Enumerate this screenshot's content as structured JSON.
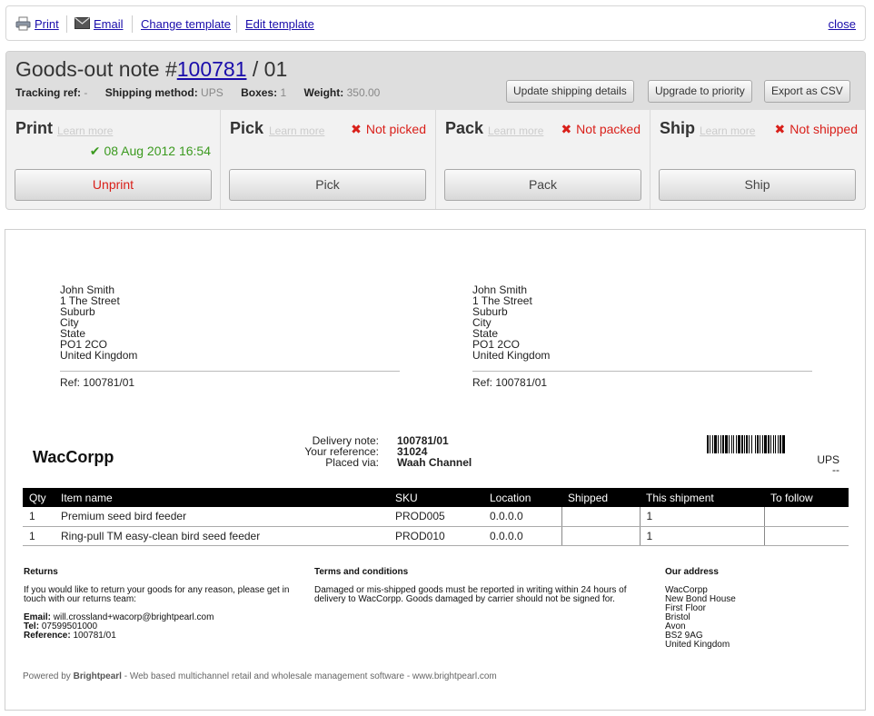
{
  "toolbar": {
    "print": "Print",
    "email": "Email",
    "change_template": "Change template",
    "edit_template": "Edit template",
    "close": "close"
  },
  "header": {
    "title_prefix": "Goods-out note #",
    "order_number": "100781",
    "title_suffix": " / 01",
    "tracking_label": "Tracking ref:",
    "tracking_value": "-",
    "shipping_label": "Shipping method:",
    "shipping_value": "UPS",
    "boxes_label": "Boxes:",
    "boxes_value": "1",
    "weight_label": "Weight:",
    "weight_value": "350.00",
    "buttons": {
      "update_shipping": "Update shipping details",
      "upgrade_priority": "Upgrade to priority",
      "export_csv": "Export as CSV"
    }
  },
  "stages": {
    "print": {
      "name": "Print",
      "learn": "Learn more",
      "done_text": "08 Aug 2012 16:54",
      "button": "Unprint"
    },
    "pick": {
      "name": "Pick",
      "learn": "Learn more",
      "status": "Not picked",
      "button": "Pick"
    },
    "pack": {
      "name": "Pack",
      "learn": "Learn more",
      "status": "Not packed",
      "button": "Pack"
    },
    "ship": {
      "name": "Ship",
      "learn": "Learn more",
      "status": "Not shipped",
      "button": "Ship"
    }
  },
  "document": {
    "address_left": [
      "John Smith",
      "1 The Street",
      "Suburb",
      "City",
      "State",
      "PO1 2CO",
      "United Kingdom"
    ],
    "address_right": [
      "John Smith",
      "1 The Street",
      "Suburb",
      "City",
      "State",
      "PO1 2CO",
      "United Kingdom"
    ],
    "ref_left": "Ref: 100781/01",
    "ref_right": "Ref: 100781/01",
    "company": "WacCorpp",
    "delivery_note_label": "Delivery note:",
    "delivery_note_value": "100781/01",
    "your_reference_label": "Your reference:",
    "your_reference_value": "31024",
    "placed_via_label": "Placed via:",
    "placed_via_value": "Waah Channel",
    "carrier": "UPS",
    "carrier_sub": "--",
    "table": {
      "headers": [
        "Qty",
        "Item name",
        "SKU",
        "Location",
        "Shipped",
        "This shipment",
        "To follow"
      ],
      "rows": [
        [
          "1",
          "Premium seed bird feeder",
          "PROD005",
          "0.0.0.0",
          "",
          "1",
          ""
        ],
        [
          "1",
          "Ring-pull TM easy-clean bird seed feeder",
          "PROD010",
          "0.0.0.0",
          "",
          "1",
          ""
        ]
      ]
    },
    "returns": {
      "title": "Returns",
      "text1": "If you would like to return your goods for any reason, please get in",
      "text2": "touch with our returns team:",
      "email_label": "Email:",
      "email_value": "will.crossland+wacorp@brightpearl.com",
      "tel_label": "Tel:",
      "tel_value": "07599501000",
      "reference_label": "Reference:",
      "reference_value": "100781/01"
    },
    "terms": {
      "title": "Terms and conditions",
      "text1": "Damaged or mis-shipped goods must be reported in writing within 24 hours of",
      "text2": "delivery to WacCorpp. Goods damaged by carrier should not be signed for."
    },
    "our_address": {
      "title": "Our address",
      "lines": [
        "WacCorpp",
        "New Bond House",
        "First Floor",
        "Bristol",
        "Avon",
        "BS2 9AG",
        "United Kingdom"
      ]
    },
    "powered_prefix": "Powered by ",
    "powered_brand": "Brightpearl",
    "powered_suffix": " - Web based multichannel retail and wholesale management software - www.brightpearl.com"
  },
  "colors": {
    "link": "#1a0dab",
    "status_red": "#d9201a",
    "done_green": "#3b9a1f"
  },
  "icons": [
    "printer-icon",
    "mail-icon",
    "cross-icon",
    "check-icon",
    "barcode"
  ]
}
